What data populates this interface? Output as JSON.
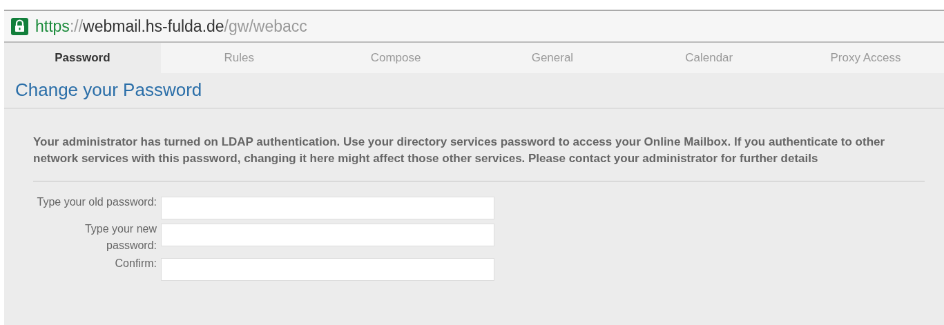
{
  "address_bar": {
    "secure": true,
    "url_parts": [
      {
        "kind": "scheme",
        "text": "https"
      },
      {
        "kind": "separator",
        "text": "://"
      },
      {
        "kind": "host",
        "text": "webmail.hs-fulda.de"
      },
      {
        "kind": "path",
        "text": "/gw/webacc"
      }
    ]
  },
  "tabs": [
    {
      "label": "Password",
      "selected": true
    },
    {
      "label": "Rules",
      "selected": false
    },
    {
      "label": "Compose",
      "selected": false
    },
    {
      "label": "General",
      "selected": false
    },
    {
      "label": "Calendar",
      "selected": false
    },
    {
      "label": "Proxy Access",
      "selected": false
    }
  ],
  "heading": "Change your Password",
  "notice": "Your administrator has turned on LDAP authentication. Use your directory services password to access your Online Mailbox. If you authenticate to other network services with this password, changing it here might affect those other services. Please contact your administrator for further details",
  "fields": [
    {
      "label": "Type your old password:"
    },
    {
      "label": "Type your new password:"
    },
    {
      "label": "Confirm:"
    }
  ]
}
